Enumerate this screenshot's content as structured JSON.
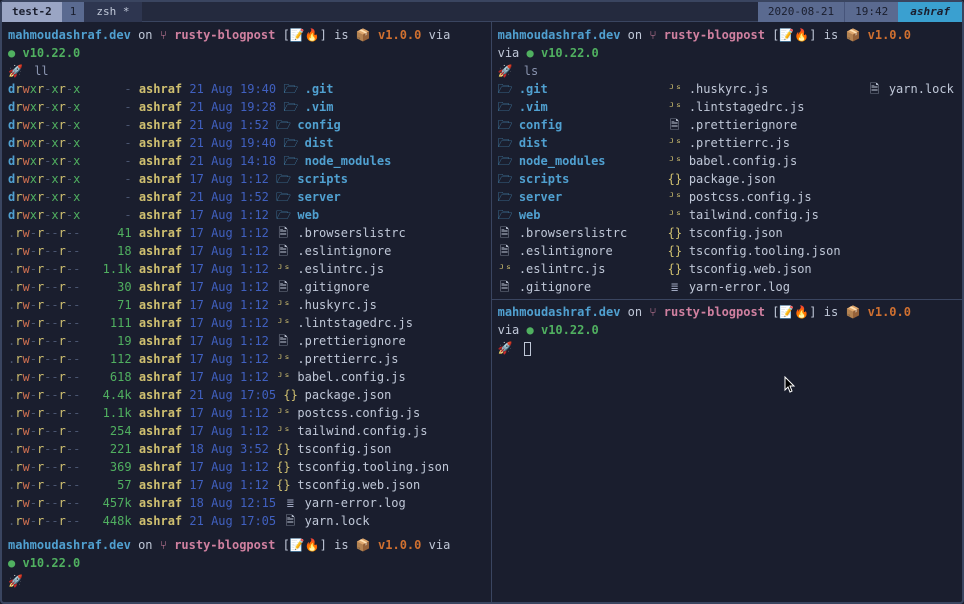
{
  "titlebar": {
    "session": "test-2",
    "window_num": "1",
    "window_name": "zsh *",
    "date": "2020-08-21",
    "time": "19:42",
    "user": "ashraf"
  },
  "prompt": {
    "host": "mahmoudashraf.dev",
    "on": "on",
    "branch_icon": "⑂",
    "branch": "rusty-blogpost",
    "emoji": "[📝🔥]",
    "is": "is",
    "pkg_icon": "📦",
    "version": "v1.0.0",
    "via": "via",
    "node_dot": "●",
    "node": "v10.22.0",
    "rocket": "🚀"
  },
  "left": {
    "cmd": "ll",
    "rows": [
      {
        "perm": "drwxr-xr-x",
        "size": "-",
        "u": "ashraf",
        "d": "21 Aug",
        "t": "19:40",
        "ic": "folder",
        "name": ".git",
        "dir": true
      },
      {
        "perm": "drwxr-xr-x",
        "size": "-",
        "u": "ashraf",
        "d": "21 Aug",
        "t": "19:28",
        "ic": "folder",
        "name": ".vim",
        "dir": true
      },
      {
        "perm": "drwxr-xr-x",
        "size": "-",
        "u": "ashraf",
        "d": "21 Aug",
        "t": "1:52",
        "ic": "folder",
        "name": "config",
        "dir": true
      },
      {
        "perm": "drwxr-xr-x",
        "size": "-",
        "u": "ashraf",
        "d": "21 Aug",
        "t": "19:40",
        "ic": "folder",
        "name": "dist",
        "dir": true
      },
      {
        "perm": "drwxr-xr-x",
        "size": "-",
        "u": "ashraf",
        "d": "21 Aug",
        "t": "14:18",
        "ic": "folder",
        "name": "node_modules",
        "dir": true
      },
      {
        "perm": "drwxr-xr-x",
        "size": "-",
        "u": "ashraf",
        "d": "17 Aug",
        "t": "1:12",
        "ic": "folder",
        "name": "scripts",
        "dir": true
      },
      {
        "perm": "drwxr-xr-x",
        "size": "-",
        "u": "ashraf",
        "d": "21 Aug",
        "t": "1:52",
        "ic": "folder",
        "name": "server",
        "dir": true
      },
      {
        "perm": "drwxr-xr-x",
        "size": "-",
        "u": "ashraf",
        "d": "17 Aug",
        "t": "1:12",
        "ic": "folder",
        "name": "web",
        "dir": true
      },
      {
        "perm": ".rw-r--r--",
        "size": "41",
        "u": "ashraf",
        "d": "17 Aug",
        "t": "1:12",
        "ic": "file",
        "name": ".browserslistrc",
        "dir": false
      },
      {
        "perm": ".rw-r--r--",
        "size": "18",
        "u": "ashraf",
        "d": "17 Aug",
        "t": "1:12",
        "ic": "file",
        "name": ".eslintignore",
        "dir": false
      },
      {
        "perm": ".rw-r--r--",
        "size": "1.1k",
        "u": "ashraf",
        "d": "17 Aug",
        "t": "1:12",
        "ic": "js",
        "name": ".eslintrc.js",
        "dir": false
      },
      {
        "perm": ".rw-r--r--",
        "size": "30",
        "u": "ashraf",
        "d": "17 Aug",
        "t": "1:12",
        "ic": "file",
        "name": ".gitignore",
        "dir": false
      },
      {
        "perm": ".rw-r--r--",
        "size": "71",
        "u": "ashraf",
        "d": "17 Aug",
        "t": "1:12",
        "ic": "js",
        "name": ".huskyrc.js",
        "dir": false
      },
      {
        "perm": ".rw-r--r--",
        "size": "111",
        "u": "ashraf",
        "d": "17 Aug",
        "t": "1:12",
        "ic": "js",
        "name": ".lintstagedrc.js",
        "dir": false
      },
      {
        "perm": ".rw-r--r--",
        "size": "19",
        "u": "ashraf",
        "d": "17 Aug",
        "t": "1:12",
        "ic": "file",
        "name": ".prettierignore",
        "dir": false
      },
      {
        "perm": ".rw-r--r--",
        "size": "112",
        "u": "ashraf",
        "d": "17 Aug",
        "t": "1:12",
        "ic": "js",
        "name": ".prettierrc.js",
        "dir": false
      },
      {
        "perm": ".rw-r--r--",
        "size": "618",
        "u": "ashraf",
        "d": "17 Aug",
        "t": "1:12",
        "ic": "js",
        "name": "babel.config.js",
        "dir": false
      },
      {
        "perm": ".rw-r--r--",
        "size": "4.4k",
        "u": "ashraf",
        "d": "21 Aug",
        "t": "17:05",
        "ic": "json",
        "name": "package.json",
        "dir": false
      },
      {
        "perm": ".rw-r--r--",
        "size": "1.1k",
        "u": "ashraf",
        "d": "17 Aug",
        "t": "1:12",
        "ic": "js",
        "name": "postcss.config.js",
        "dir": false
      },
      {
        "perm": ".rw-r--r--",
        "size": "254",
        "u": "ashraf",
        "d": "17 Aug",
        "t": "1:12",
        "ic": "js",
        "name": "tailwind.config.js",
        "dir": false
      },
      {
        "perm": ".rw-r--r--",
        "size": "221",
        "u": "ashraf",
        "d": "18 Aug",
        "t": "3:52",
        "ic": "json",
        "name": "tsconfig.json",
        "dir": false
      },
      {
        "perm": ".rw-r--r--",
        "size": "369",
        "u": "ashraf",
        "d": "17 Aug",
        "t": "1:12",
        "ic": "json",
        "name": "tsconfig.tooling.json",
        "dir": false
      },
      {
        "perm": ".rw-r--r--",
        "size": "57",
        "u": "ashraf",
        "d": "17 Aug",
        "t": "1:12",
        "ic": "json",
        "name": "tsconfig.web.json",
        "dir": false
      },
      {
        "perm": ".rw-r--r--",
        "size": "457k",
        "u": "ashraf",
        "d": "18 Aug",
        "t": "12:15",
        "ic": "log",
        "name": "yarn-error.log",
        "dir": false
      },
      {
        "perm": ".rw-r--r--",
        "size": "448k",
        "u": "ashraf",
        "d": "21 Aug",
        "t": "17:05",
        "ic": "file",
        "name": "yarn.lock",
        "dir": false
      }
    ]
  },
  "right": {
    "cmd": "ls",
    "col1": [
      {
        "ic": "folder",
        "name": ".git",
        "dir": true
      },
      {
        "ic": "folder",
        "name": ".vim",
        "dir": true
      },
      {
        "ic": "folder",
        "name": "config",
        "dir": true
      },
      {
        "ic": "folder",
        "name": "dist",
        "dir": true
      },
      {
        "ic": "folder",
        "name": "node_modules",
        "dir": true
      },
      {
        "ic": "folder",
        "name": "scripts",
        "dir": true
      },
      {
        "ic": "folder",
        "name": "server",
        "dir": true
      },
      {
        "ic": "folder",
        "name": "web",
        "dir": true
      },
      {
        "ic": "file",
        "name": ".browserslistrc",
        "dir": false
      },
      {
        "ic": "file",
        "name": ".eslintignore",
        "dir": false
      },
      {
        "ic": "js",
        "name": ".eslintrc.js",
        "dir": false
      },
      {
        "ic": "file",
        "name": ".gitignore",
        "dir": false
      }
    ],
    "col2": [
      {
        "ic": "js",
        "name": ".huskyrc.js",
        "dir": false
      },
      {
        "ic": "js",
        "name": ".lintstagedrc.js",
        "dir": false
      },
      {
        "ic": "file",
        "name": ".prettierignore",
        "dir": false
      },
      {
        "ic": "js",
        "name": ".prettierrc.js",
        "dir": false
      },
      {
        "ic": "js",
        "name": "babel.config.js",
        "dir": false
      },
      {
        "ic": "json",
        "name": "package.json",
        "dir": false
      },
      {
        "ic": "js",
        "name": "postcss.config.js",
        "dir": false
      },
      {
        "ic": "js",
        "name": "tailwind.config.js",
        "dir": false
      },
      {
        "ic": "json",
        "name": "tsconfig.json",
        "dir": false
      },
      {
        "ic": "json",
        "name": "tsconfig.tooling.json",
        "dir": false
      },
      {
        "ic": "json",
        "name": "tsconfig.web.json",
        "dir": false
      },
      {
        "ic": "log",
        "name": "yarn-error.log",
        "dir": false
      }
    ],
    "col3": [
      {
        "ic": "file",
        "name": "yarn.lock",
        "dir": false
      }
    ]
  },
  "icons": {
    "folder": "🗁",
    "file": "🗎",
    "js": "ᴶˢ",
    "json": "{}",
    "log": "≣"
  }
}
